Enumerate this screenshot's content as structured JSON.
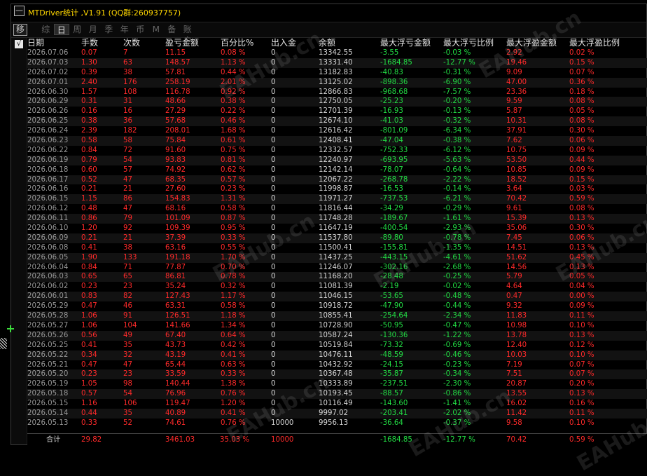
{
  "title_bar": {
    "collapse_icon": "minus-icon",
    "collapse_label": "—",
    "title": "MTDriver统计 ,V1.91 (QQ群:260937757)"
  },
  "toolbar": {
    "move_label": "移",
    "tabs": [
      "综",
      "日",
      "周",
      "月",
      "季",
      "年",
      "币",
      "M",
      "备",
      "账户"
    ],
    "active_tab_index": 1
  },
  "side": {
    "check_label": "√"
  },
  "table": {
    "headers": [
      "日期",
      "手数",
      "次数",
      "盈亏金额",
      "百分比%",
      "出入金",
      "余额",
      "最大浮亏金额",
      "最大浮亏比例",
      "最大浮盈金额",
      "最大浮盈比例"
    ],
    "rows": [
      [
        "2026.07.06",
        "0.07",
        "7",
        "11.15",
        "0.08 %",
        "0",
        "13342.55",
        "-3.55",
        "-0.03 %",
        "2.92",
        "0.02 %"
      ],
      [
        "2026.07.03",
        "1.30",
        "63",
        "148.57",
        "1.13 %",
        "0",
        "13331.40",
        "-1684.85",
        "-12.77 %",
        "19.46",
        "0.15 %"
      ],
      [
        "2026.07.02",
        "0.39",
        "38",
        "57.81",
        "0.44 %",
        "0",
        "13182.83",
        "-40.83",
        "-0.31 %",
        "9.09",
        "0.07 %"
      ],
      [
        "2026.07.01",
        "2.40",
        "176",
        "258.19",
        "2.01 %",
        "0",
        "13125.02",
        "-898.36",
        "-6.90 %",
        "47.00",
        "0.36 %"
      ],
      [
        "2026.06.30",
        "1.57",
        "108",
        "116.78",
        "0.92 %",
        "0",
        "12866.83",
        "-968.68",
        "-7.57 %",
        "23.36",
        "0.18 %"
      ],
      [
        "2026.06.29",
        "0.31",
        "31",
        "48.66",
        "0.38 %",
        "0",
        "12750.05",
        "-25.23",
        "-0.20 %",
        "9.59",
        "0.08 %"
      ],
      [
        "2026.06.26",
        "0.16",
        "16",
        "27.29",
        "0.22 %",
        "0",
        "12701.39",
        "-16.93",
        "-0.13 %",
        "5.87",
        "0.05 %"
      ],
      [
        "2026.06.25",
        "0.38",
        "36",
        "57.68",
        "0.46 %",
        "0",
        "12674.10",
        "-41.03",
        "-0.32 %",
        "10.31",
        "0.08 %"
      ],
      [
        "2026.06.24",
        "2.39",
        "182",
        "208.01",
        "1.68 %",
        "0",
        "12616.42",
        "-801.09",
        "-6.34 %",
        "37.91",
        "0.30 %"
      ],
      [
        "2026.06.23",
        "0.58",
        "58",
        "75.84",
        "0.61 %",
        "0",
        "12408.41",
        "-47.04",
        "-0.38 %",
        "7.62",
        "0.06 %"
      ],
      [
        "2026.06.22",
        "0.84",
        "72",
        "91.60",
        "0.75 %",
        "0",
        "12332.57",
        "-752.33",
        "-6.12 %",
        "10.75",
        "0.09 %"
      ],
      [
        "2026.06.19",
        "0.79",
        "54",
        "93.83",
        "0.81 %",
        "0",
        "12240.97",
        "-693.95",
        "-5.63 %",
        "53.50",
        "0.44 %"
      ],
      [
        "2026.06.18",
        "0.60",
        "57",
        "74.92",
        "0.62 %",
        "0",
        "12142.14",
        "-78.07",
        "-0.64 %",
        "10.85",
        "0.09 %"
      ],
      [
        "2026.06.17",
        "0.52",
        "47",
        "68.35",
        "0.57 %",
        "0",
        "12067.22",
        "-268.78",
        "-2.22 %",
        "18.52",
        "0.15 %"
      ],
      [
        "2026.06.16",
        "0.21",
        "21",
        "27.60",
        "0.23 %",
        "0",
        "11998.87",
        "-16.53",
        "-0.14 %",
        "3.64",
        "0.03 %"
      ],
      [
        "2026.06.15",
        "1.15",
        "86",
        "154.83",
        "1.31 %",
        "0",
        "11971.27",
        "-737.53",
        "-6.21 %",
        "70.42",
        "0.59 %"
      ],
      [
        "2026.06.12",
        "0.48",
        "47",
        "68.16",
        "0.58 %",
        "0",
        "11816.44",
        "-34.29",
        "-0.29 %",
        "9.61",
        "0.08 %"
      ],
      [
        "2026.06.11",
        "0.86",
        "79",
        "101.09",
        "0.87 %",
        "0",
        "11748.28",
        "-189.67",
        "-1.61 %",
        "15.39",
        "0.13 %"
      ],
      [
        "2026.06.10",
        "1.20",
        "92",
        "109.39",
        "0.95 %",
        "0",
        "11647.19",
        "-400.54",
        "-2.93 %",
        "35.06",
        "0.30 %"
      ],
      [
        "2026.06.09",
        "0.21",
        "21",
        "37.39",
        "0.33 %",
        "0",
        "11537.80",
        "-89.80",
        "-0.78 %",
        "7.45",
        "0.06 %"
      ],
      [
        "2026.06.08",
        "0.41",
        "38",
        "63.16",
        "0.55 %",
        "0",
        "11500.41",
        "-155.81",
        "-1.35 %",
        "14.51",
        "0.13 %"
      ],
      [
        "2026.06.05",
        "1.90",
        "133",
        "191.18",
        "1.70 %",
        "0",
        "11437.25",
        "-443.15",
        "-4.61 %",
        "51.62",
        "0.45 %"
      ],
      [
        "2026.06.04",
        "0.84",
        "71",
        "77.87",
        "0.70 %",
        "0",
        "11246.07",
        "-302.16",
        "-2.68 %",
        "14.56",
        "0.13 %"
      ],
      [
        "2026.06.03",
        "0.65",
        "65",
        "86.81",
        "0.78 %",
        "0",
        "11168.20",
        "-28.48",
        "-0.25 %",
        "5.79",
        "0.05 %"
      ],
      [
        "2026.06.02",
        "0.23",
        "23",
        "35.24",
        "0.32 %",
        "0",
        "11081.39",
        "-2.19",
        "-0.02 %",
        "4.64",
        "0.04 %"
      ],
      [
        "2026.06.01",
        "0.83",
        "82",
        "127.43",
        "1.17 %",
        "0",
        "11046.15",
        "-53.65",
        "-0.48 %",
        "0.47",
        "0.00 %"
      ],
      [
        "2026.05.29",
        "0.47",
        "46",
        "63.31",
        "0.58 %",
        "0",
        "10918.72",
        "-47.90",
        "-0.44 %",
        "9.32",
        "0.09 %"
      ],
      [
        "2026.05.28",
        "1.06",
        "91",
        "126.51",
        "1.18 %",
        "0",
        "10855.41",
        "-254.64",
        "-2.34 %",
        "11.83",
        "0.11 %"
      ],
      [
        "2026.05.27",
        "1.06",
        "104",
        "141.66",
        "1.34 %",
        "0",
        "10728.90",
        "-50.95",
        "-0.47 %",
        "10.98",
        "0.10 %"
      ],
      [
        "2026.05.26",
        "0.56",
        "49",
        "67.40",
        "0.64 %",
        "0",
        "10587.24",
        "-130.36",
        "-1.22 %",
        "13.78",
        "0.13 %"
      ],
      [
        "2026.05.25",
        "0.41",
        "35",
        "43.73",
        "0.42 %",
        "0",
        "10519.84",
        "-73.32",
        "-0.69 %",
        "12.40",
        "0.12 %"
      ],
      [
        "2026.05.22",
        "0.34",
        "32",
        "43.19",
        "0.41 %",
        "0",
        "10476.11",
        "-48.59",
        "-0.46 %",
        "10.03",
        "0.10 %"
      ],
      [
        "2026.05.21",
        "0.47",
        "47",
        "65.44",
        "0.63 %",
        "0",
        "10432.92",
        "-24.15",
        "-0.23 %",
        "7.19",
        "0.07 %"
      ],
      [
        "2026.05.20",
        "0.23",
        "23",
        "33.59",
        "0.33 %",
        "0",
        "10367.48",
        "-35.87",
        "-0.34 %",
        "7.51",
        "0.07 %"
      ],
      [
        "2026.05.19",
        "1.05",
        "98",
        "140.44",
        "1.38 %",
        "0",
        "10333.89",
        "-237.51",
        "-2.30 %",
        "20.87",
        "0.20 %"
      ],
      [
        "2026.05.18",
        "0.57",
        "54",
        "76.96",
        "0.76 %",
        "0",
        "10193.45",
        "-88.57",
        "-0.86 %",
        "13.55",
        "0.13 %"
      ],
      [
        "2026.05.15",
        "1.16",
        "106",
        "119.47",
        "1.20 %",
        "0",
        "10116.49",
        "-143.60",
        "-1.41 %",
        "16.02",
        "0.16 %"
      ],
      [
        "2026.05.14",
        "0.44",
        "35",
        "40.89",
        "0.41 %",
        "0",
        "9997.02",
        "-203.41",
        "-2.02 %",
        "11.42",
        "0.11 %"
      ],
      [
        "2026.05.13",
        "0.33",
        "52",
        "74.61",
        "0.76 %",
        "10000",
        "9956.13",
        "-36.64",
        "-0.37 %",
        "9.58",
        "0.10 %"
      ]
    ],
    "total": [
      "合计",
      "29.82",
      "",
      "3461.03",
      "35.03 %",
      "10000",
      "",
      "-1684.85",
      "-12.77 %",
      "70.42",
      "0.59 %"
    ]
  },
  "watermark": "EAHub.cn",
  "colors": {
    "profit": "#ff2a2a",
    "loss": "#22dd44",
    "title": "#ffd700",
    "date": "#9a9a9a"
  }
}
